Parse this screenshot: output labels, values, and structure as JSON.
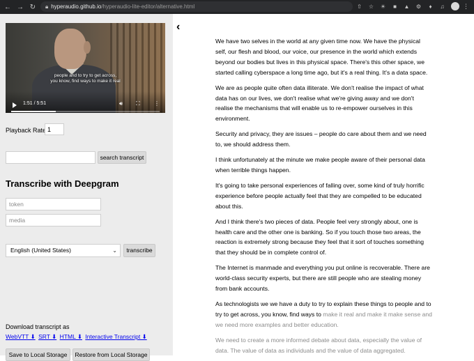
{
  "browser": {
    "url_domain": "hyperaudio.github.io",
    "url_path": "/hyperaudio-lite-editor/alternative.html"
  },
  "video": {
    "caption_line1": "people and to try to get across,",
    "caption_line2": "you know, find ways to make it real",
    "time": "1:51 / 5:51",
    "progress_fraction": 0.3
  },
  "playback": {
    "label": "Playback Rate",
    "value": "1"
  },
  "search": {
    "button_label": "search transcript"
  },
  "deepgram": {
    "heading": "Transcribe with Deepgram",
    "token_placeholder": "token",
    "media_placeholder": "media",
    "language": "English (United States)",
    "transcribe_label": "transcribe"
  },
  "download": {
    "label": "Download transcript as",
    "webvtt": "WebVTT ⬇",
    "srt": "SRT ⬇",
    "html": "HTML ⬇",
    "interactive": "Interactive Transcript ⬇"
  },
  "storage": {
    "save_label": "Save to Local Storage",
    "restore_label": "Restore from Local Storage"
  },
  "transcript": {
    "p1": "We have two selves in the world at any given time now. We have the physical self, our flesh and blood, our voice, our presence in the world which extends beyond our bodies but lives in this physical space. There's this other space, we started calling cyberspace a long time ago, but it's a real thing. It's a data space.",
    "p2": "We are as people quite often data illiterate. We don't realise the impact of what data has on our lives, we don't realise what we're giving away and we don't realise the mechanisms that will enable us to re-empower ourselves in this environment.",
    "p3": "Security and privacy, they are issues – people do care about them and we need to, we should address them.",
    "p4": "I think unfortunately at the minute we make people aware of their personal data when terrible things happen.",
    "p5": "It's going to take personal experiences of falling over, some kind of truly horrific experience before people actually feel that they are compelled to be educated about this.",
    "p6": "And I think there's two pieces of data. People feel very strongly about, one is health care and the other one is banking. So if you touch those two areas, the reaction is extremely strong because they feel that it sort of touches something that they should be in complete control of.",
    "p7": "The Internet is manmade and everything you put online is recoverable. There are world-class security experts, but there are still people who are stealing money from bank accounts.",
    "p8_played": "As technologists we we have a duty to try to explain these things to people and to try to get across, you know, find ways to ",
    "p8_unplayed": "make it real and make it make sense and we need more examples and better education.",
    "p9": "We need to create a more informed debate about data, especially the value of data. The value of data as individuals and the value of data aggregated."
  }
}
